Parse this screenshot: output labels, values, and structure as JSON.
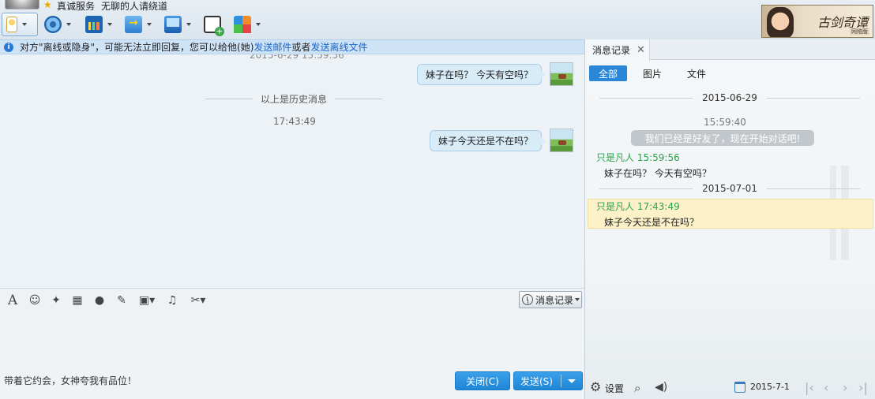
{
  "header": {
    "status_left": "真诚服务",
    "status_signature": "无聊的人请绕道",
    "game_title": "古剑奇谭",
    "game_sub": "网络版"
  },
  "toolbar": {
    "items": [
      "mic-icon",
      "camera-icon",
      "whiteboard-icon",
      "file-transfer-icon",
      "screen-share-icon",
      "add-chat-icon",
      "apps-icon"
    ]
  },
  "notice": {
    "text_prefix": "对方\"离线或隐身\"，可能无法立即回复，您可以给他(她)",
    "link_email": "发送邮件",
    "text_mid": "或者",
    "link_offline_file": "发送离线文件"
  },
  "chat": {
    "cut_timestamp": "2015-6-29 15:59:56",
    "messages": [
      {
        "text": "妹子在吗？  今天有空吗？"
      },
      {
        "text": "妹子今天还是不在吗？"
      }
    ],
    "history_divider": "以上是历史消息",
    "timestamp": "17:43:49"
  },
  "input": {
    "history_button": "消息记录",
    "ad_text": "带着它约会，女神夸我有品位！",
    "close_button": "关闭(C)",
    "send_button": "发送(S)"
  },
  "panel": {
    "tab_label": "消息记录",
    "filters": [
      "全部",
      "图片",
      "文件"
    ],
    "date1": "2015-06-29",
    "time1": "15:59:40",
    "system_message": "我们已经是好友了，现在开始对话吧!",
    "entries": [
      {
        "sender": "只是凡人 15:59:56",
        "text": "妹子在吗？  今天有空吗？"
      },
      {
        "sender": "只是凡人 17:43:49",
        "text": "妹子今天还是不在吗？"
      }
    ],
    "date2": "2015-07-01",
    "settings_label": "设置",
    "calendar_date": "2015-7-1"
  }
}
